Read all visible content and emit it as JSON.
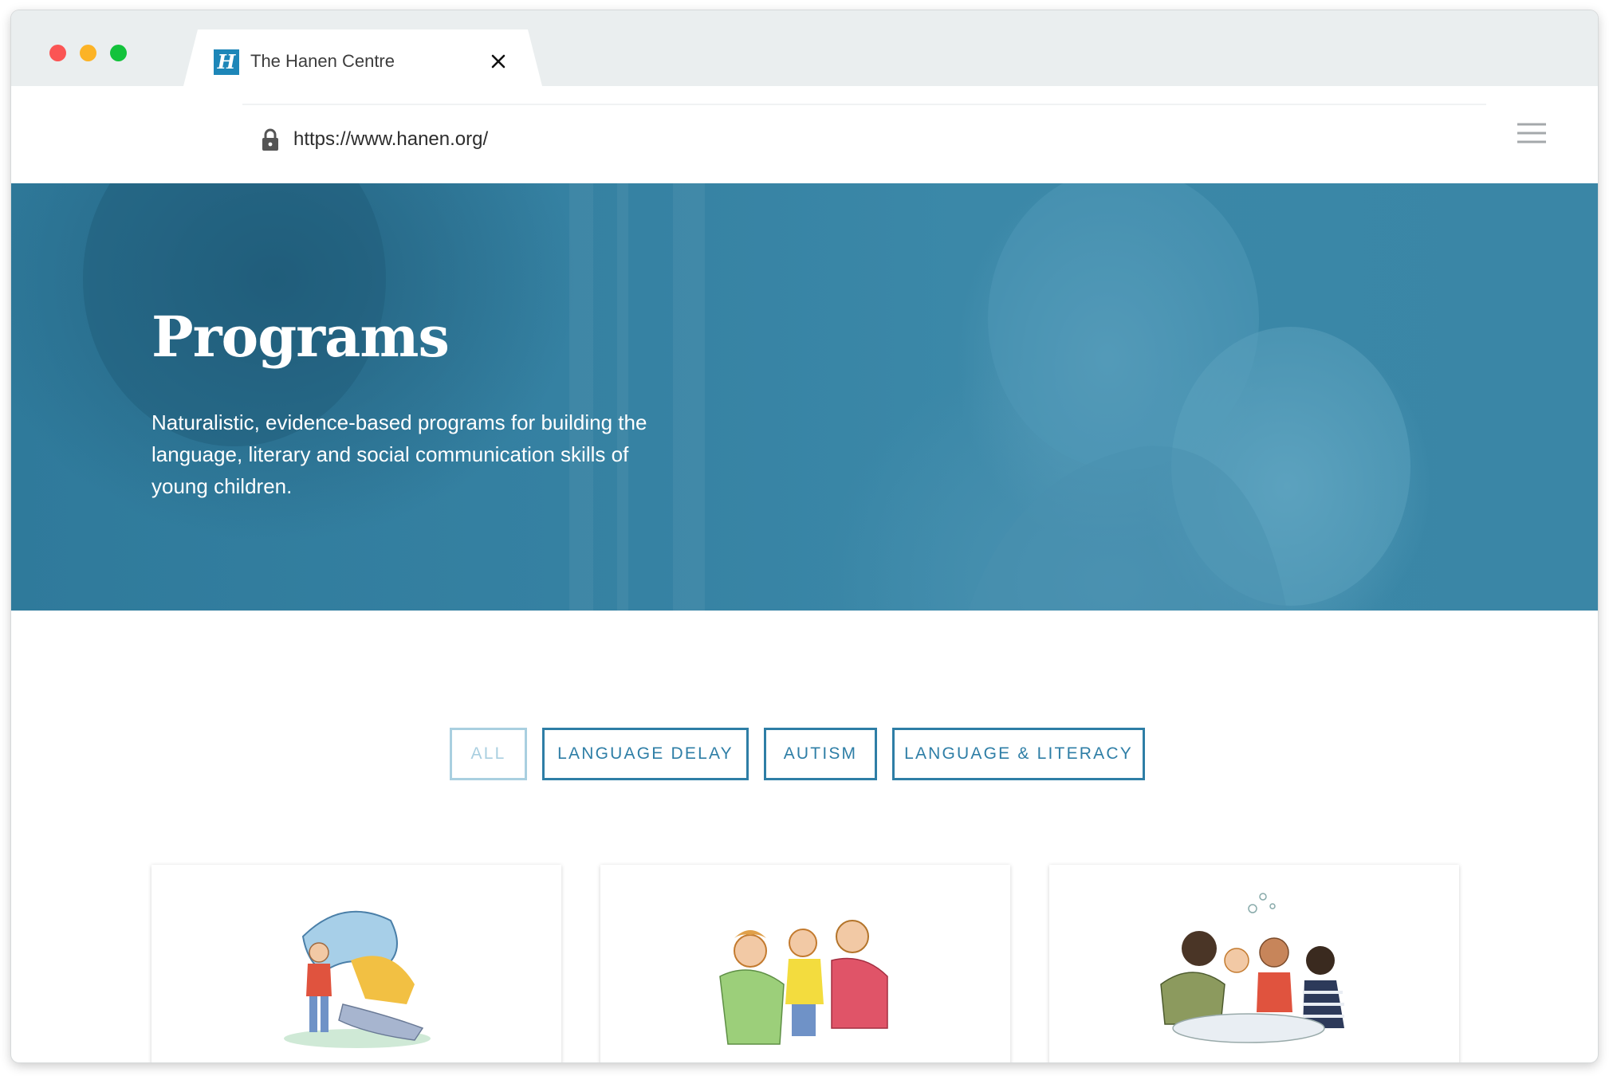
{
  "browser": {
    "tab_title": "The Hanen Centre",
    "favicon_letter": "H",
    "url": "https://www.hanen.org/",
    "icons": [
      "close-icon",
      "back-arrow-icon",
      "forward-arrow-icon",
      "reload-icon",
      "lock-icon",
      "menu-icon"
    ]
  },
  "hero": {
    "title": "Programs",
    "description": "Naturalistic, evidence-based programs for building the language, literary and social communication skills of young children."
  },
  "filters": [
    {
      "label": "ALL",
      "active": true
    },
    {
      "label": "LANGUAGE DELAY",
      "active": false
    },
    {
      "label": "AUTISM",
      "active": false
    },
    {
      "label": "LANGUAGE & LITERACY",
      "active": false
    }
  ],
  "cards": [
    {
      "illustration": "parent-and-child-playing-under-blanket"
    },
    {
      "illustration": "family-hugging-child"
    },
    {
      "illustration": "children-playing-with-bubbles"
    }
  ],
  "colors": {
    "accent": "#2e7ea6",
    "accent_inactive": "#a9cfe0",
    "hero_overlay": "#3583a4"
  }
}
